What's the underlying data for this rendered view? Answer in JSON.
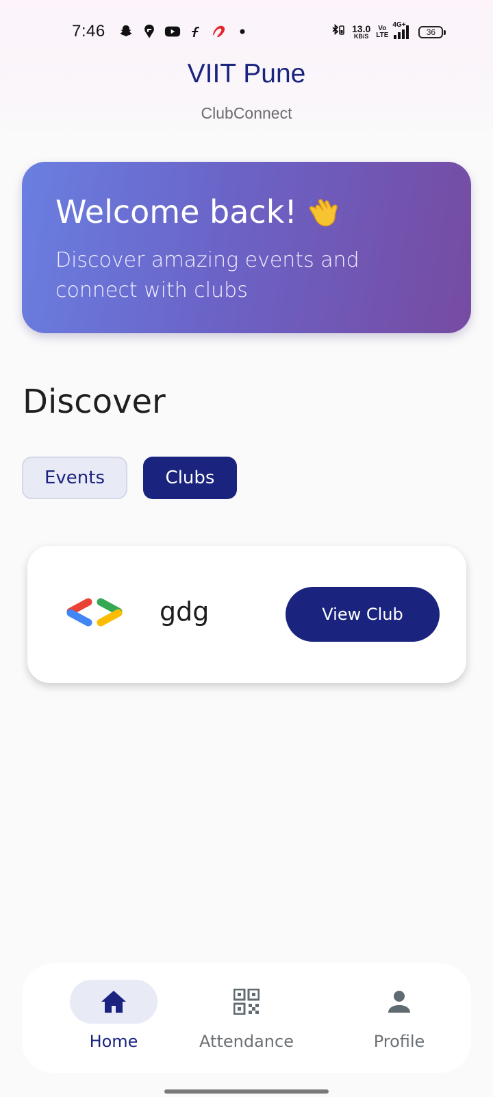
{
  "status_bar": {
    "time": "7:46",
    "net_speed_value": "13.0",
    "net_speed_unit": "KB/S",
    "volte_top": "Vo",
    "volte_bottom": "LTE",
    "network_type": "4G+",
    "battery": "36",
    "icons_left": [
      "snapchat-icon",
      "swiggy-icon",
      "youtube-icon",
      "flipkart-icon",
      "airtel-icon",
      "dot-icon"
    ],
    "icons_right": [
      "bluetooth-icon",
      "signal-icon"
    ]
  },
  "header": {
    "title": "VIIT Pune",
    "subtitle": "ClubConnect"
  },
  "welcome": {
    "title": "Welcome back!",
    "emoji_icon": "waving-hand-icon",
    "subtitle": "Discover amazing events and connect with clubs"
  },
  "discover": {
    "title": "Discover",
    "chips": [
      {
        "label": "Events",
        "selected": false
      },
      {
        "label": "Clubs",
        "selected": true
      }
    ]
  },
  "clubs": [
    {
      "name": "gdg",
      "logo_icon": "gdg-logo-icon",
      "action_label": "View Club"
    }
  ],
  "bottom_nav": {
    "items": [
      {
        "label": "Home",
        "icon": "home-icon",
        "active": true
      },
      {
        "label": "Attendance",
        "icon": "qr-code-icon",
        "active": false
      },
      {
        "label": "Profile",
        "icon": "person-icon",
        "active": false
      }
    ]
  },
  "colors": {
    "primary": "#1a237e",
    "gradient_start": "#6a7fe0",
    "gradient_end": "#764ba2",
    "chip_unselected_bg": "#e8eaf6",
    "background": "#fafafa"
  }
}
